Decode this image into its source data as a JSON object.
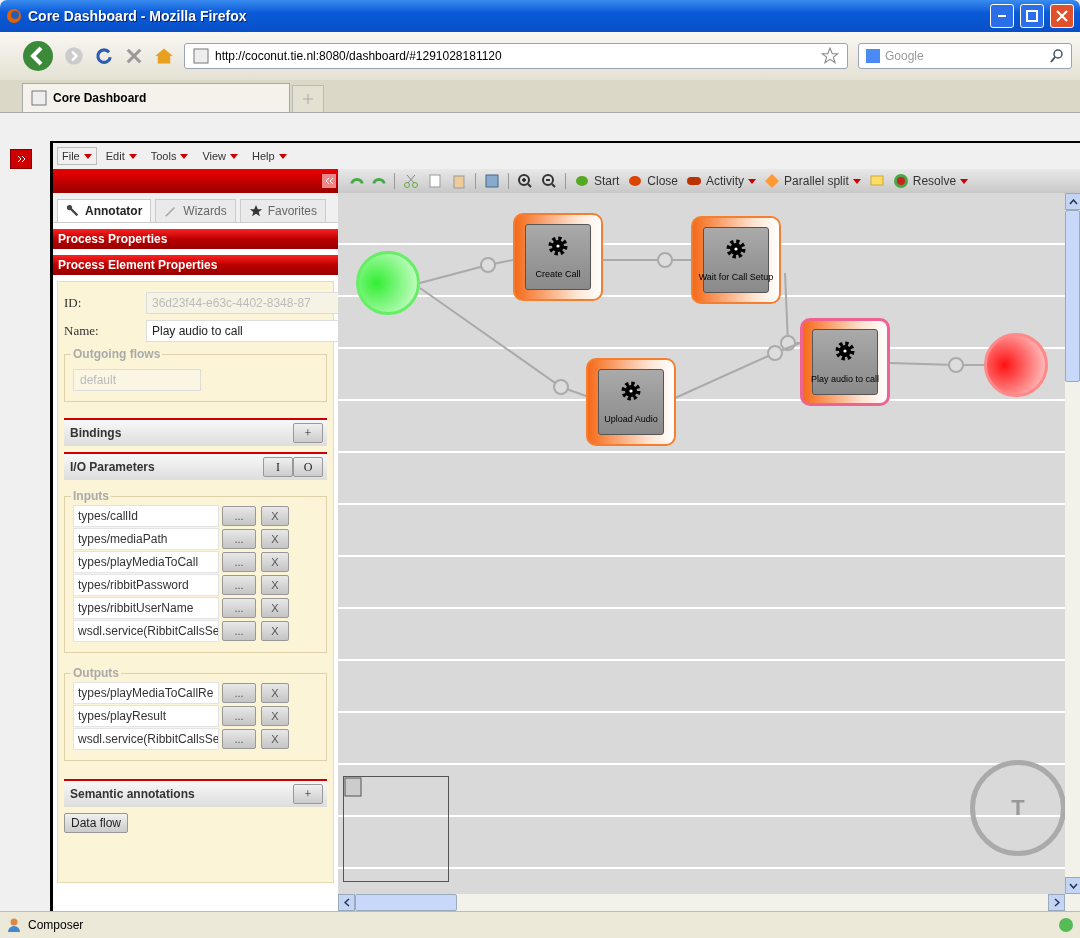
{
  "window": {
    "title": "Core Dashboard - Mozilla Firefox"
  },
  "navigation": {
    "url": "http://coconut.tie.nl:8080/dashboard/#1291028181120",
    "search_placeholder": "Google"
  },
  "tabs": [
    {
      "label": "Core Dashboard",
      "selected": true
    }
  ],
  "menu": [
    {
      "label": "File",
      "selected": true
    },
    {
      "label": "Edit",
      "selected": false
    },
    {
      "label": "Tools",
      "selected": false
    },
    {
      "label": "View",
      "selected": false
    },
    {
      "label": "Help",
      "selected": false
    }
  ],
  "toolbar": [
    {
      "label": "Start",
      "menu": false
    },
    {
      "label": "Close",
      "menu": false
    },
    {
      "label": "Activity",
      "menu": true
    },
    {
      "label": "Parallel split",
      "menu": true
    },
    {
      "label": "Resolve",
      "menu": true
    }
  ],
  "panel_tabs": [
    {
      "label": "Annotator",
      "selected": true
    },
    {
      "label": "Wizards",
      "selected": false
    },
    {
      "label": "Favorites",
      "selected": false
    }
  ],
  "sections": [
    "Process Properties",
    "Process Element Properties"
  ],
  "element": {
    "id_label": "ID:",
    "id_value": "36d23f44-e63c-4402-8348-87",
    "name_label": "Name:",
    "name_value": "Play audio to call",
    "outgoing_title": "Outgoing flows",
    "outgoing_value": "default"
  },
  "bindings": {
    "title": "Bindings",
    "add": "+"
  },
  "io": {
    "title": "I/O Parameters",
    "buttons": [
      "I",
      "O"
    ],
    "inputs_title": "Inputs",
    "inputs": [
      {
        "value": "types/callId",
        "browse": "...",
        "remove": "X"
      },
      {
        "value": "types/mediaPath",
        "browse": "...",
        "remove": "X"
      },
      {
        "value": "types/playMediaToCall",
        "browse": "...",
        "remove": "X"
      },
      {
        "value": "types/ribbitPassword",
        "browse": "...",
        "remove": "X"
      },
      {
        "value": "types/ribbitUserName",
        "browse": "...",
        "remove": "X"
      },
      {
        "value": "wsdl.service(RibbitCallsSe",
        "browse": "...",
        "remove": "X"
      }
    ],
    "outputs_title": "Outputs",
    "outputs": [
      {
        "value": "types/playMediaToCallRe",
        "browse": "...",
        "remove": "X"
      },
      {
        "value": "types/playResult",
        "browse": "...",
        "remove": "X"
      },
      {
        "value": "wsdl.service(RibbitCallsSe",
        "browse": "...",
        "remove": "X"
      }
    ]
  },
  "semantic": {
    "title": "Semantic annotations",
    "add": "+"
  },
  "data_flow_button": "Data flow",
  "nodes": [
    {
      "kind": "start"
    },
    {
      "kind": "task",
      "label": "Create Call",
      "selected": false
    },
    {
      "kind": "task",
      "label": "Wait for Call Setup",
      "selected": false
    },
    {
      "kind": "task",
      "label": "Upload Audio",
      "selected": false
    },
    {
      "kind": "task",
      "label": "Play audio to call",
      "selected": true
    },
    {
      "kind": "end"
    }
  ],
  "compass": "T",
  "status_bar": {
    "text": "Composer"
  }
}
